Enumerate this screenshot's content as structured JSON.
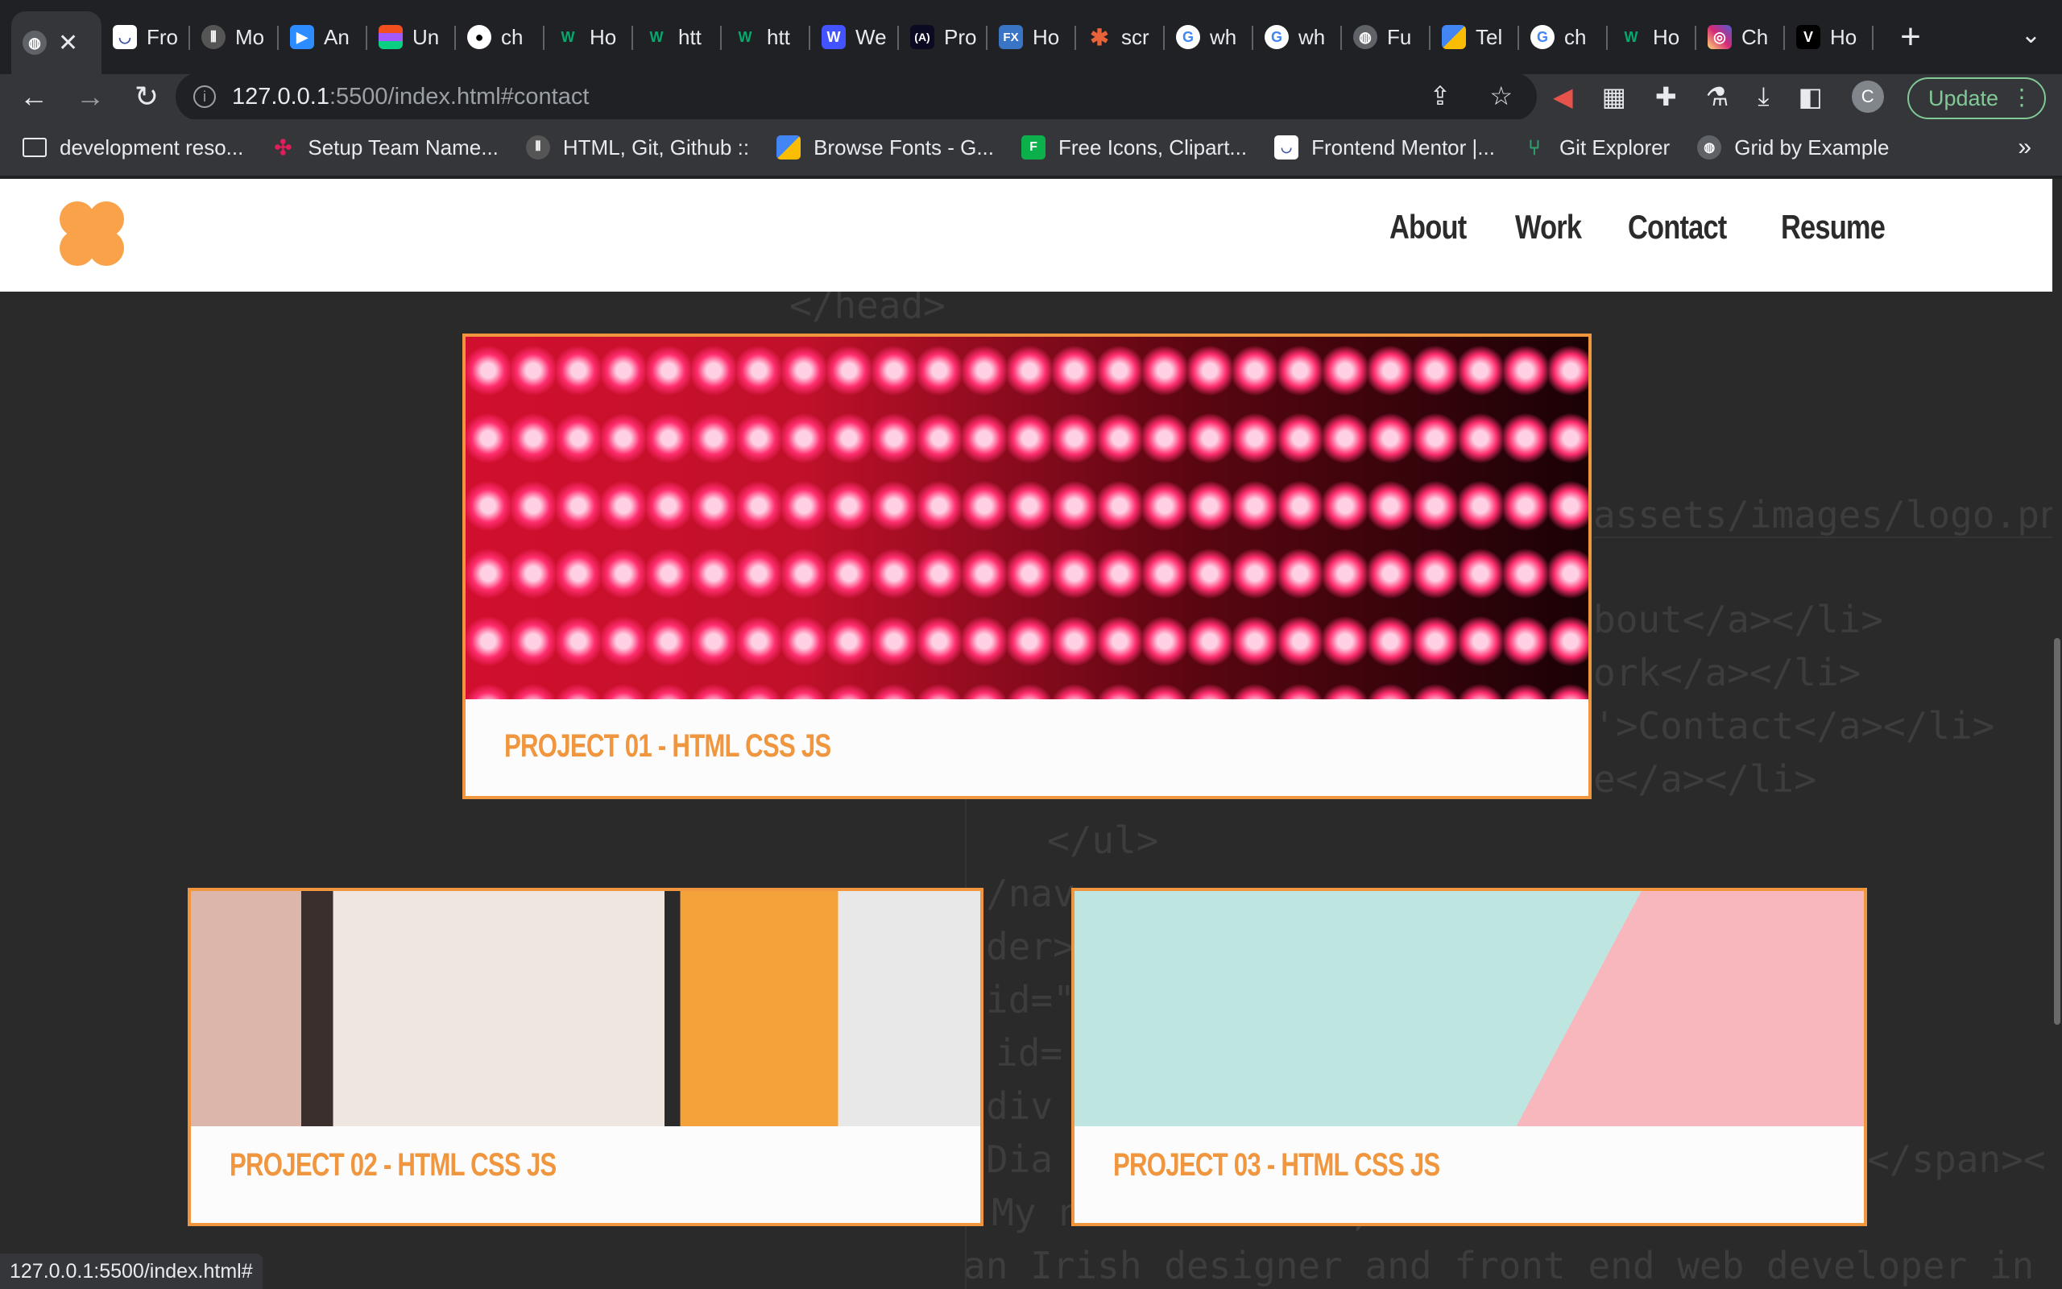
{
  "tabs": [
    {
      "label": "",
      "favicon": "globe-icon",
      "active": true
    },
    {
      "label": "Fro",
      "favicon": "frontendmentor-icon"
    },
    {
      "label": "Mo",
      "favicon": "theodinproject-icon"
    },
    {
      "label": "An",
      "favicon": "zoom-icon"
    },
    {
      "label": "Un",
      "favicon": "figma-icon"
    },
    {
      "label": "ch",
      "favicon": "github-icon"
    },
    {
      "label": "Ho",
      "favicon": "w3schools-icon"
    },
    {
      "label": "htt",
      "favicon": "w3schools-icon"
    },
    {
      "label": "htt",
      "favicon": "w3schools-icon"
    },
    {
      "label": "We",
      "favicon": "webflow-icon"
    },
    {
      "label": "Pro",
      "favicon": "freecodecamp-icon"
    },
    {
      "label": "Ho",
      "favicon": "fx-icon"
    },
    {
      "label": "scr",
      "favicon": "asterisk-icon"
    },
    {
      "label": "wh",
      "favicon": "google-icon"
    },
    {
      "label": "wh",
      "favicon": "google-icon"
    },
    {
      "label": "Fu",
      "favicon": "globe-icon"
    },
    {
      "label": "Tel",
      "favicon": "google-fonts-icon"
    },
    {
      "label": "ch",
      "favicon": "google-icon"
    },
    {
      "label": "Ho",
      "favicon": "w3schools-icon"
    },
    {
      "label": "Ch",
      "favicon": "instagram-icon"
    },
    {
      "label": "Ho",
      "favicon": "v-icon"
    }
  ],
  "toolbar": {
    "url_host": "127.0.0.1",
    "url_path": ":5500/index.html#contact",
    "profile_initial": "C",
    "update_label": "Update"
  },
  "bookmarks": [
    {
      "label": "development reso...",
      "icon": "folder-icon"
    },
    {
      "label": "Setup Team Name...",
      "icon": "slack-icon"
    },
    {
      "label": "HTML, Git, Github ::",
      "icon": "theodinproject-icon"
    },
    {
      "label": "Browse Fonts - G...",
      "icon": "google-fonts-icon"
    },
    {
      "label": "Free Icons, Clipart...",
      "icon": "flaticon-icon"
    },
    {
      "label": "Frontend Mentor |...",
      "icon": "frontendmentor-icon"
    },
    {
      "label": "Git Explorer",
      "icon": "git-icon"
    },
    {
      "label": "Grid by Example",
      "icon": "globe-icon"
    }
  ],
  "site": {
    "nav": [
      "About",
      "Work",
      "Contact",
      "Resume"
    ],
    "projects": [
      {
        "title": "PROJECT 01 - HTML CSS JS"
      },
      {
        "title": "PROJECT 02 - HTML CSS JS"
      },
      {
        "title": "PROJECT 03 - HTML CSS JS"
      }
    ],
    "background_code": [
      "</head>",
      "assets/images/logo.png",
      "bout</a></li>",
      "ork</a></li>",
      "'>Contact</a></li>",
      "e</a></li>",
      "</ul>",
      "/nav",
      "der>",
      "id=\"",
      "id=",
      "div",
      "Dia",
      "</span><",
      "i! My name is Chris,",
      "an Irish designer and front end web developer in"
    ]
  },
  "status_url": "127.0.0.1:5500/index.html#",
  "colors": {
    "accent": "#f0963e",
    "page_bg": "#2a2a2a",
    "chrome_dark": "#202124",
    "chrome_toolbar": "#35363a",
    "update_green": "#81c995"
  }
}
